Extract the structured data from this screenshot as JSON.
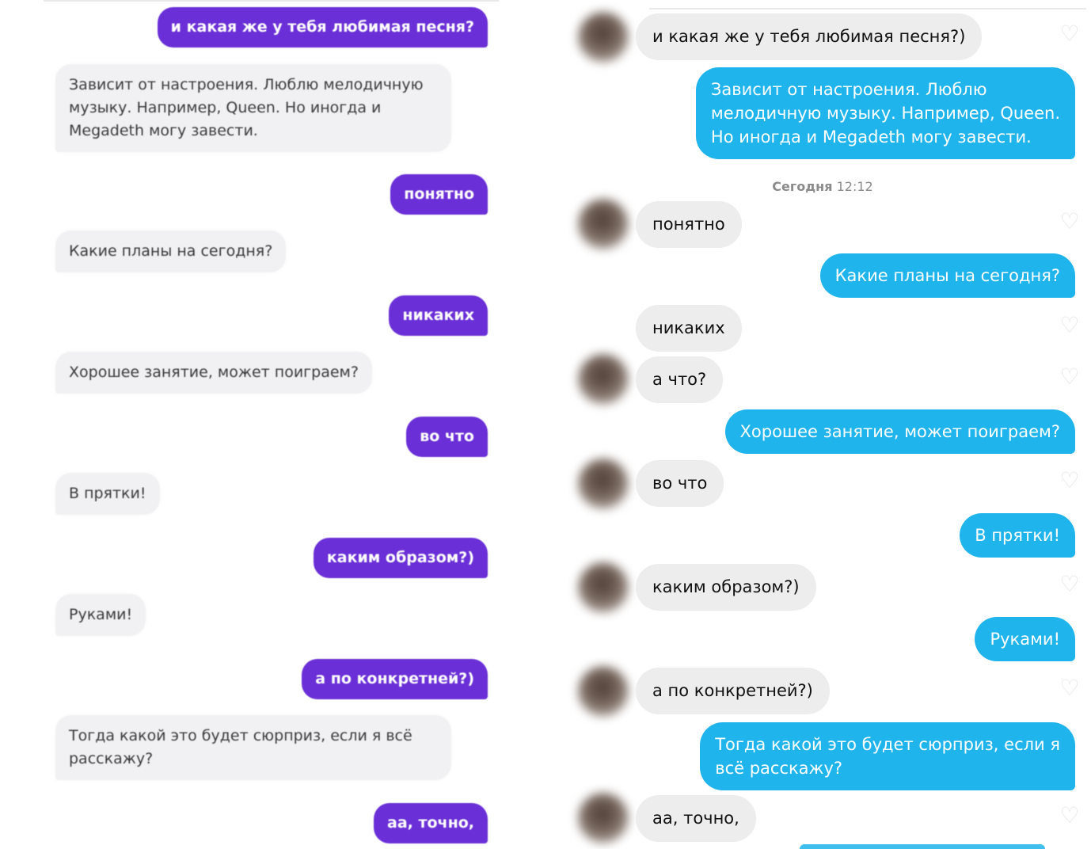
{
  "left_chat": {
    "messages": [
      {
        "dir": "out",
        "text": "и какая же у тебя любимая песня?"
      },
      {
        "dir": "in",
        "lines": [
          "Зависит от настроения. Люблю мелодичную",
          "музыку. Например, Queen. Но иногда и",
          "Megadeth могу завести."
        ]
      },
      {
        "dir": "out",
        "text": "понятно"
      },
      {
        "dir": "in",
        "text": "Какие планы на сегодня?"
      },
      {
        "dir": "out",
        "text": "никаких"
      },
      {
        "dir": "in",
        "text": "Хорошее занятие, может поиграем?"
      },
      {
        "dir": "out",
        "text": "во что"
      },
      {
        "dir": "in",
        "text": "В прятки!"
      },
      {
        "dir": "out",
        "text": "каким образом?)"
      },
      {
        "dir": "in",
        "text": "Руками!"
      },
      {
        "dir": "out",
        "text": "а по конкретней?)"
      },
      {
        "dir": "in",
        "lines": [
          "Тогда какой это будет сюрприз, если я всё",
          "расскажу?"
        ]
      },
      {
        "dir": "out",
        "text": "аа, точно,"
      }
    ],
    "colors": {
      "outgoing": "#6a2fd6",
      "incoming": "#f1f1f3"
    }
  },
  "right_chat": {
    "divider": {
      "day": "Сегодня",
      "time": "12:12"
    },
    "messages": [
      {
        "dir": "in",
        "text": "и какая же у тебя любимая песня?)"
      },
      {
        "dir": "out",
        "lines": [
          "Зависит от настроения. Люблю",
          "мелодичную музыку. Например, Queen.",
          "Но иногда и Megadeth могу завести."
        ]
      },
      {
        "dir": "in",
        "text": "понятно"
      },
      {
        "dir": "out",
        "text": "Какие планы на сегодня?"
      },
      {
        "dir": "in",
        "text": "никаких"
      },
      {
        "dir": "in",
        "text": "а что?"
      },
      {
        "dir": "out",
        "text": "Хорошее занятие, может поиграем?"
      },
      {
        "dir": "in",
        "text": "во что"
      },
      {
        "dir": "out",
        "text": "В прятки!"
      },
      {
        "dir": "in",
        "text": "каким образом?)"
      },
      {
        "dir": "out",
        "text": "Руками!"
      },
      {
        "dir": "in",
        "text": "а по конкретней?)"
      },
      {
        "dir": "out",
        "lines": [
          "Тогда какой это будет сюрприз, если я",
          "всё расскажу?"
        ]
      },
      {
        "dir": "in",
        "text": "аа, точно,"
      }
    ],
    "icons": {
      "avatar": "blurred-avatar",
      "like": "heart-outline-icon"
    },
    "colors": {
      "outgoing": "#1fb4ec",
      "incoming": "#ededed"
    }
  }
}
